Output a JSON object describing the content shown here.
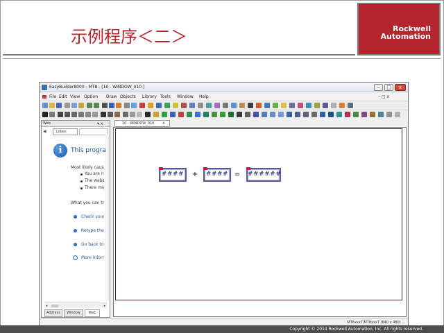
{
  "slide": {
    "title": "示例程序＜二＞",
    "logo_line1": "Rockwell",
    "logo_line2": "Automation",
    "copyright": "Copyright © 2014 Rockwell Automation, Inc. All rights reserved.",
    "accent_color": "#b3262d"
  },
  "window": {
    "title": "EasyBuilder8000 - MT8 - [10 - WINDOW_010 ]",
    "controls": {
      "minimize": "–",
      "maximize": "□",
      "close": "x"
    },
    "mdi_controls": "– □ x"
  },
  "menu": [
    "File",
    "Edit",
    "View",
    "Option",
    "Draw",
    "Objects",
    "Library",
    "Tools",
    "Window",
    "Help"
  ],
  "panel": {
    "title": "Web",
    "controls": "▾ x",
    "back_icon": "◀",
    "tab_label": "Lobes",
    "info_heading": "This program",
    "line1": "Most likely causes:",
    "bullets": [
      "You are not connected",
      "The website is",
      "There might be"
    ],
    "what_you_can": "What you can try:",
    "links": [
      "Check your",
      "Retype the",
      "Go back to"
    ],
    "more_info": "More information",
    "bottom_tabs": [
      "Address",
      "Window",
      "Web"
    ]
  },
  "document": {
    "tab_label": "10 - WINDOW_010",
    "tab_close": "x",
    "numeric1": "####",
    "numeric2": "####",
    "result": "######",
    "op_plus": "+",
    "op_equals": "="
  },
  "status": {
    "text": "MT6xxxT/MT8xxxT (640 x 480) ..."
  }
}
